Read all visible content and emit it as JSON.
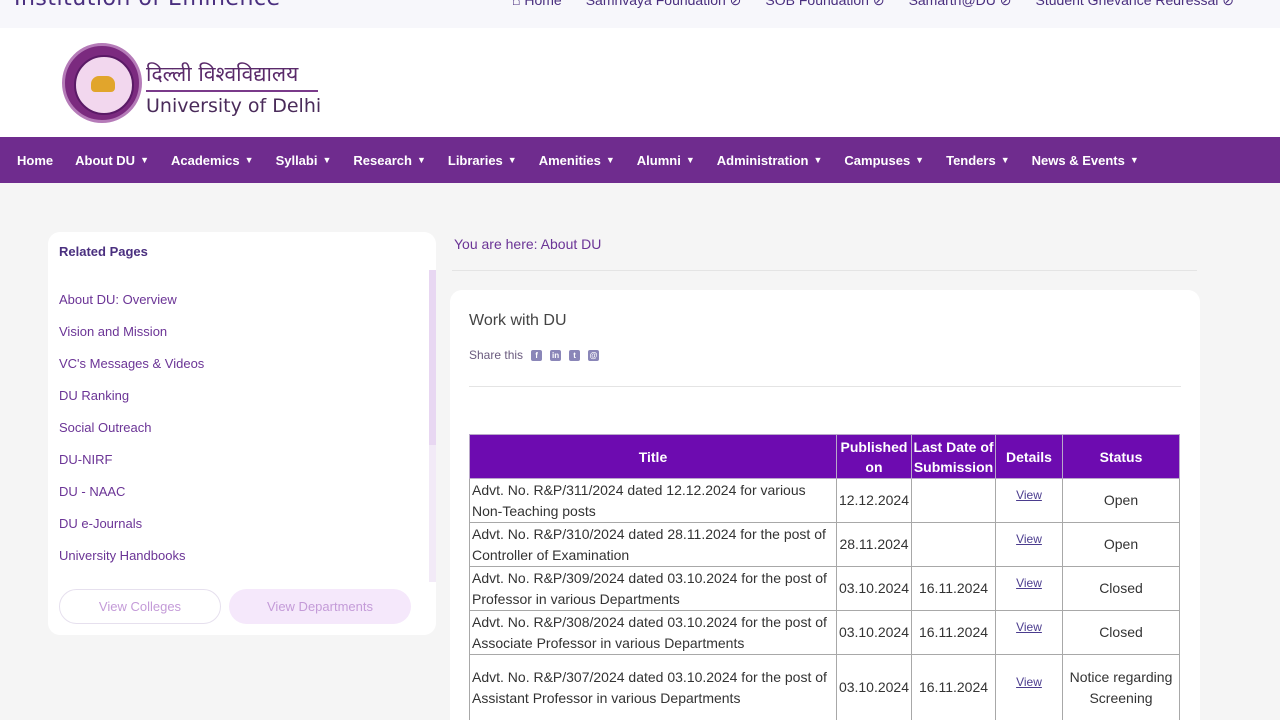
{
  "topbar": {
    "institution_text": "Institution of Eminence",
    "links": [
      "⌂ Home",
      "Samnvaya Foundation ⊘",
      "SOB Foundation ⊘",
      "Samarth@DU ⊘",
      "Student Grievance Redressal ⊘"
    ]
  },
  "header": {
    "hindi_name": "दिल्ली विश्वविद्यालय",
    "english_name": "University of Delhi",
    "brand_color": "#6f2c8e"
  },
  "nav": {
    "items": [
      {
        "label": "Home",
        "has_dropdown": false
      },
      {
        "label": "About DU",
        "has_dropdown": true
      },
      {
        "label": "Academics",
        "has_dropdown": true
      },
      {
        "label": "Syllabi",
        "has_dropdown": true
      },
      {
        "label": "Research",
        "has_dropdown": true
      },
      {
        "label": "Libraries",
        "has_dropdown": true
      },
      {
        "label": "Amenities",
        "has_dropdown": true
      },
      {
        "label": "Alumni",
        "has_dropdown": true
      },
      {
        "label": "Administration",
        "has_dropdown": true
      },
      {
        "label": "Campuses",
        "has_dropdown": true
      },
      {
        "label": "Tenders",
        "has_dropdown": true
      },
      {
        "label": "News & Events",
        "has_dropdown": true
      }
    ]
  },
  "sidebar": {
    "title": "Related Pages",
    "items": [
      "About DU: Overview",
      "Vision and Mission",
      "VC's Messages & Videos",
      "DU Ranking",
      "Social Outreach",
      "DU-NIRF",
      "DU - NAAC",
      "DU e-Journals",
      "University Handbooks"
    ],
    "view_colleges_label": "View Colleges",
    "view_departments_label": "View Departments"
  },
  "breadcrumb": "You are here: About DU",
  "main": {
    "page_title": "Work with DU",
    "share_label": "Share this",
    "share_icons": [
      "facebook-icon",
      "linkedin-icon",
      "twitter-icon",
      "email-icon"
    ],
    "table": {
      "headers": [
        "Title",
        "Published on",
        "Last Date of Submission",
        "Details",
        "Status"
      ],
      "rows": [
        {
          "title": "Advt. No. R&P/311/2024 dated 12.12.2024 for various Non-Teaching posts",
          "published": "12.12.2024",
          "last_date": "",
          "details": "View",
          "status": "Open"
        },
        {
          "title": "Advt. No. R&P/310/2024 dated 28.11.2024 for the post of Controller of Examination",
          "published": "28.11.2024",
          "last_date": "",
          "details": "View",
          "status": "Open"
        },
        {
          "title": "Advt. No. R&P/309/2024 dated 03.10.2024 for the post of Professor in various Departments",
          "published": "03.10.2024",
          "last_date": "16.11.2024",
          "details": "View",
          "status": "Closed"
        },
        {
          "title": "Advt. No. R&P/308/2024 dated 03.10.2024 for the post of Associate Professor in various Departments",
          "published": "03.10.2024",
          "last_date": "16.11.2024",
          "details": "View",
          "status": "Closed"
        },
        {
          "title": "Advt. No. R&P/307/2024 dated 03.10.2024 for the post of Assistant Professor in various Departments",
          "published": "03.10.2024",
          "last_date": "16.11.2024",
          "details": "View",
          "status": "Notice regarding Screening"
        }
      ]
    }
  }
}
